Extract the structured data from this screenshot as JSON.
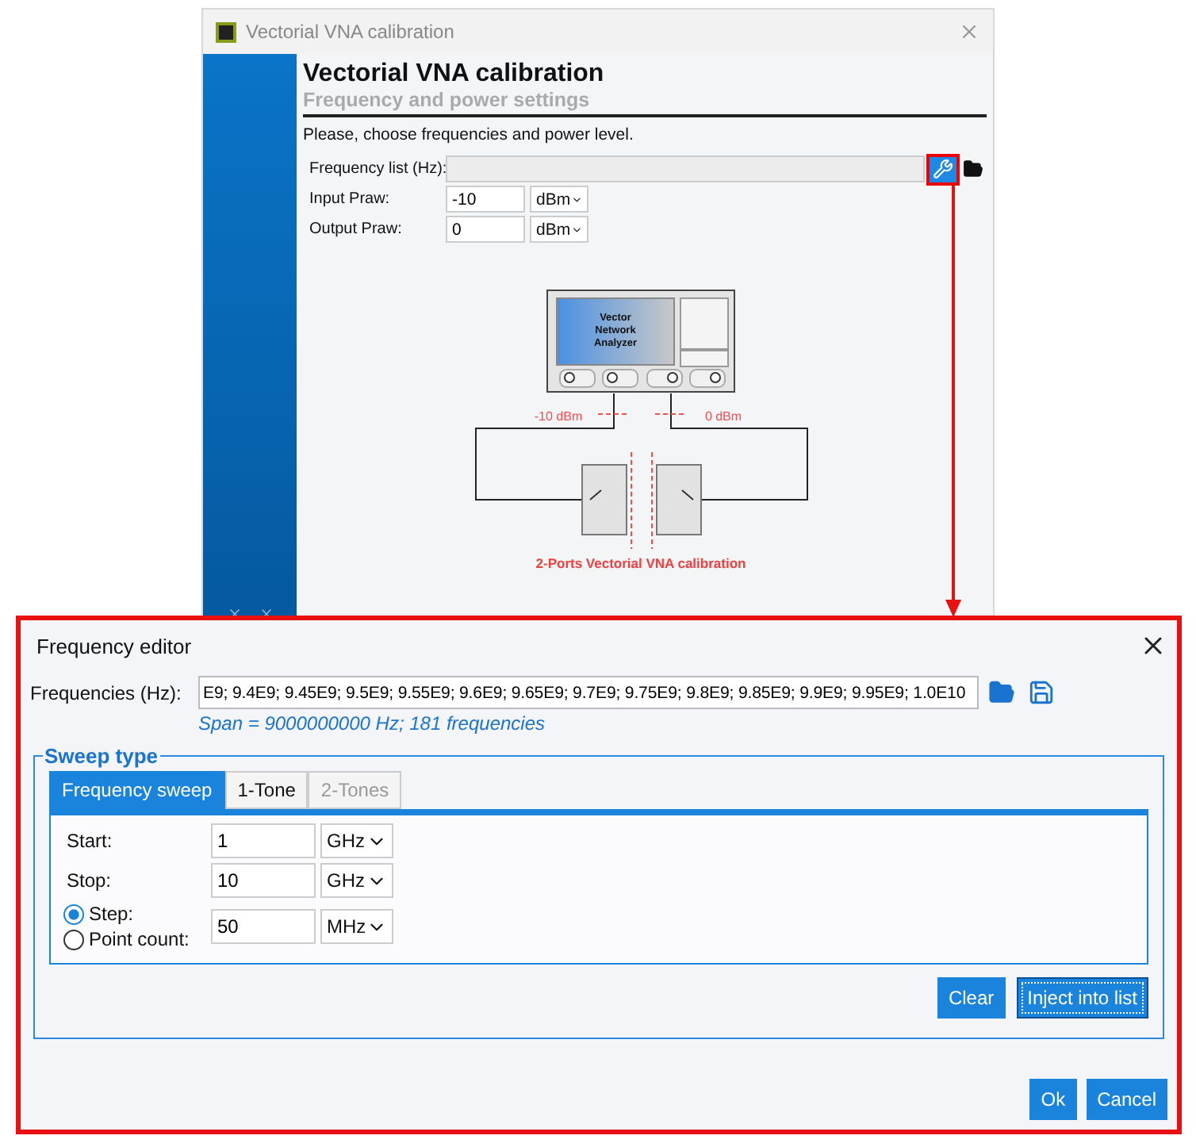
{
  "back_window": {
    "title": "Vectorial VNA calibration",
    "heading": "Vectorial VNA calibration",
    "subheading": "Frequency and power settings",
    "instruction": "Please, choose frequencies and power level.",
    "fields": [
      {
        "kind": "list",
        "label": "Frequency list (Hz):"
      },
      {
        "kind": "power",
        "label": "Input Praw:",
        "value": "-10",
        "unit": "dBm"
      },
      {
        "kind": "power",
        "label": "Output Praw:",
        "value": "0",
        "unit": "dBm"
      }
    ],
    "diagram": {
      "screen_text": "Vector Network Analyzer",
      "input_level": "-10 dBm",
      "output_level": "0 dBm",
      "caption": "2-Ports Vectorial VNA calibration"
    }
  },
  "frequency_editor": {
    "title": "Frequency editor",
    "frequencies_label": "Frequencies (Hz):",
    "frequencies_value": "E9; 9.4E9; 9.45E9; 9.5E9; 9.55E9; 9.6E9; 9.65E9; 9.7E9; 9.75E9; 9.8E9; 9.85E9; 9.9E9; 9.95E9; 1.0E10",
    "span_note": "Span = 9000000000 Hz; 181 frequencies",
    "sweep_group": {
      "title": "Sweep type",
      "tabs": [
        {
          "label": "Frequency sweep",
          "selected": true,
          "disabled": false
        },
        {
          "label": "1-Tone",
          "selected": false,
          "disabled": false
        },
        {
          "label": "2-Tones",
          "selected": false,
          "disabled": true
        }
      ],
      "rows": [
        {
          "kind": "plain",
          "label": "Start:",
          "value": "1",
          "unit": "GHz"
        },
        {
          "kind": "plain",
          "label": "Stop:",
          "value": "10",
          "unit": "GHz"
        },
        {
          "kind": "radio",
          "options": [
            {
              "label": "Step:",
              "selected": true
            },
            {
              "label": "Point count:",
              "selected": false
            }
          ],
          "value": "50",
          "unit": "MHz"
        }
      ],
      "buttons": [
        {
          "label": "Clear",
          "focused": false
        },
        {
          "label": "Inject into list",
          "focused": true
        }
      ]
    },
    "buttons": [
      "Ok",
      "Cancel"
    ]
  }
}
